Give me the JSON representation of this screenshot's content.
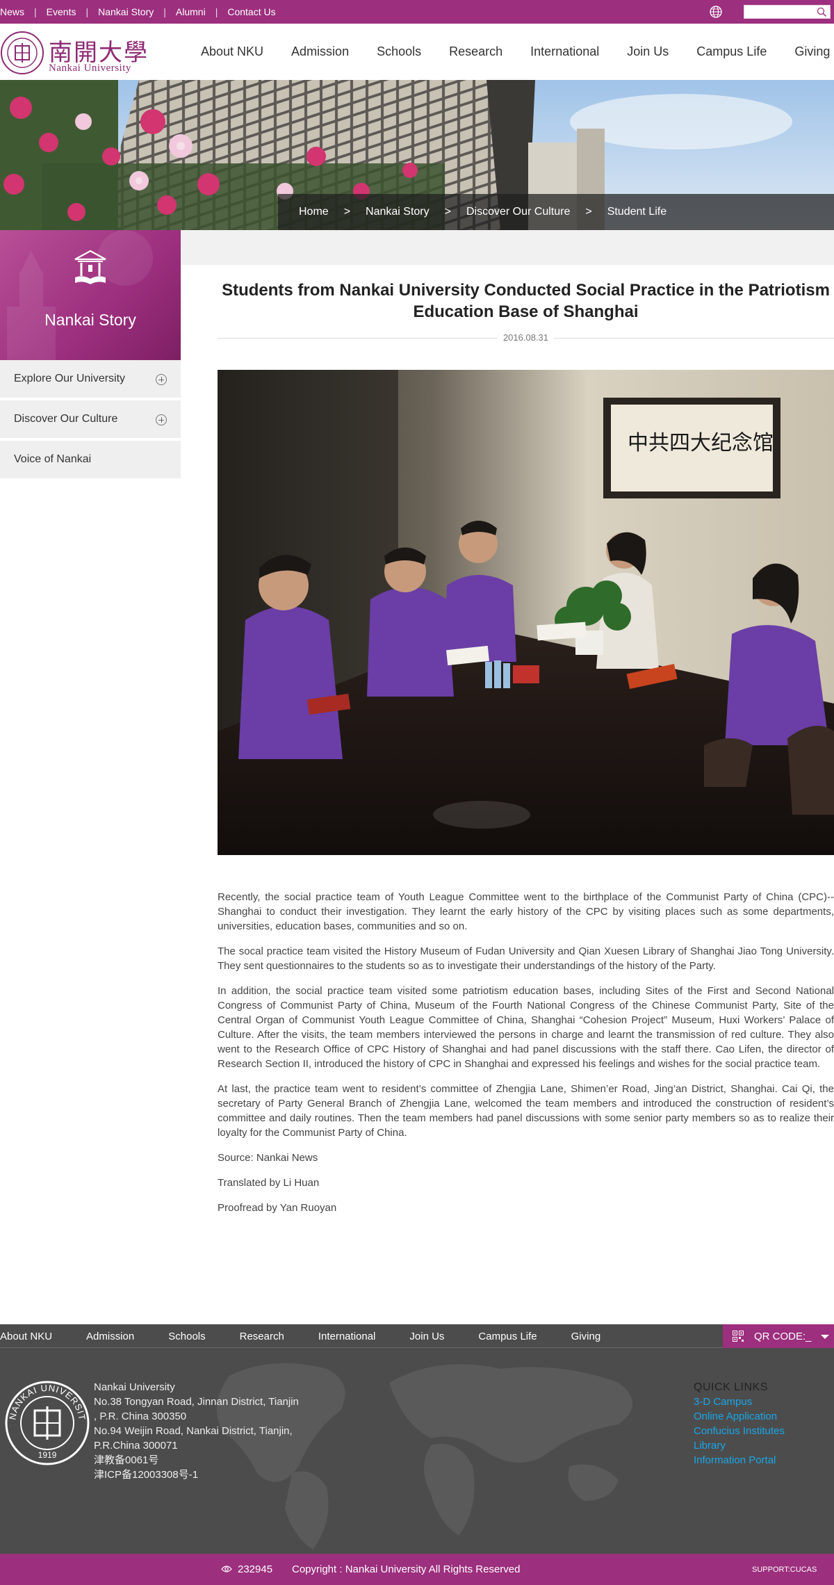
{
  "topbar": {
    "links": [
      "News",
      "Events",
      "Nankai Story",
      "Alumni",
      "Contact Us"
    ],
    "search_placeholder": ""
  },
  "logo": {
    "cn": "南開大學",
    "en": "Nankai University"
  },
  "main_nav": [
    "About NKU",
    "Admission",
    "Schools",
    "Research",
    "International",
    "Join Us",
    "Campus Life",
    "Giving"
  ],
  "breadcrumb": [
    "Home",
    "Nankai Story",
    "Discover Our Culture",
    "Student Life"
  ],
  "breadcrumb_sep": ">",
  "sidebar": {
    "title": "Nankai Story",
    "items": [
      {
        "label": "Explore Our University",
        "expandable": true
      },
      {
        "label": "Discover Our Culture",
        "expandable": true
      },
      {
        "label": "Voice of Nankai",
        "expandable": false
      }
    ]
  },
  "article": {
    "title": "Students from Nankai University Conducted Social Practice in the Patriotism Education Base of Shanghai",
    "date": "2016.08.31",
    "photo_wall_text": "中共四大纪念馆",
    "paragraphs": [
      "Recently, the social practice team of Youth League Committee went to the birthplace of the Communist Party of China (CPC)-- Shanghai to conduct their investigation. They learnt the early history of the CPC by visiting places such as some departments, universities, education bases, communities and so on.",
      "The socal practice team visited the History Museum of Fudan University and Qian Xuesen Library of Shanghai Jiao Tong University. They sent questionnaires to the students so as to investigate their understandings of the history of the Party.",
      "In addition, the social practice team visited some patriotism education bases, including Sites of the First and Second National Congress of Communist Party of China, Museum of the Fourth National Congress of the Chinese Communist Party, Site of the Central Organ of Communist Youth League Committee of China, Shanghai “Cohesion Project” Museum, Huxi Workers’ Palace of Culture. After the visits, the team members interviewed the persons in charge and learnt the transmission of red culture. They also went to the Research Office of CPC History of Shanghai and had panel discussions with the staff there. Cao Lifen, the director of Research Section II, introduced the history of CPC in Shanghai and expressed his feelings and wishes for the social practice team.",
      "At last, the practice team went to resident’s committee of Zhengjia Lane, Shimen’er Road, Jing’an District, Shanghai. Cai Qi, the secretary of Party General Branch of Zhengjia Lane, welcomed the team members and introduced the construction of resident’s committee and daily routines. Then the team members had panel discussions with some senior party members so as to realize their loyalty for the Communist Party of China.",
      "Source: Nankai News",
      "Translated by Li Huan",
      "Proofread by Yan Ruoyan"
    ]
  },
  "footer": {
    "nav": [
      "About NKU",
      "Admission",
      "Schools",
      "Research",
      "International",
      "Join Us",
      "Campus Life",
      "Giving"
    ],
    "qr_label": "QR CODE:_",
    "seal_text": "NANKAI UNIVERSITY",
    "seal_year": "1919",
    "address_lines": [
      "Nankai University",
      "No.38 Tongyan Road, Jinnan District, Tianjin",
      ", P.R. China 300350",
      "No.94 Weijin Road,  Nankai District, Tianjin,",
      "P.R.China  300071",
      "津教备0061号",
      "津ICP备12003308号-1"
    ],
    "quick_links_title": "QUICK LINKS",
    "quick_links": [
      "3-D Campus",
      "Online Application",
      "Confucius Institutes",
      "Library",
      "Information Portal"
    ],
    "visits": "232945",
    "copyright": "Copyright : Nankai University All Rights Reserved",
    "support": "SUPPORT:CUCAS"
  },
  "colors": {
    "brand": "#9c2f7e",
    "footer_bg": "#4c4c4c",
    "link_blue": "#1aa7e8"
  }
}
